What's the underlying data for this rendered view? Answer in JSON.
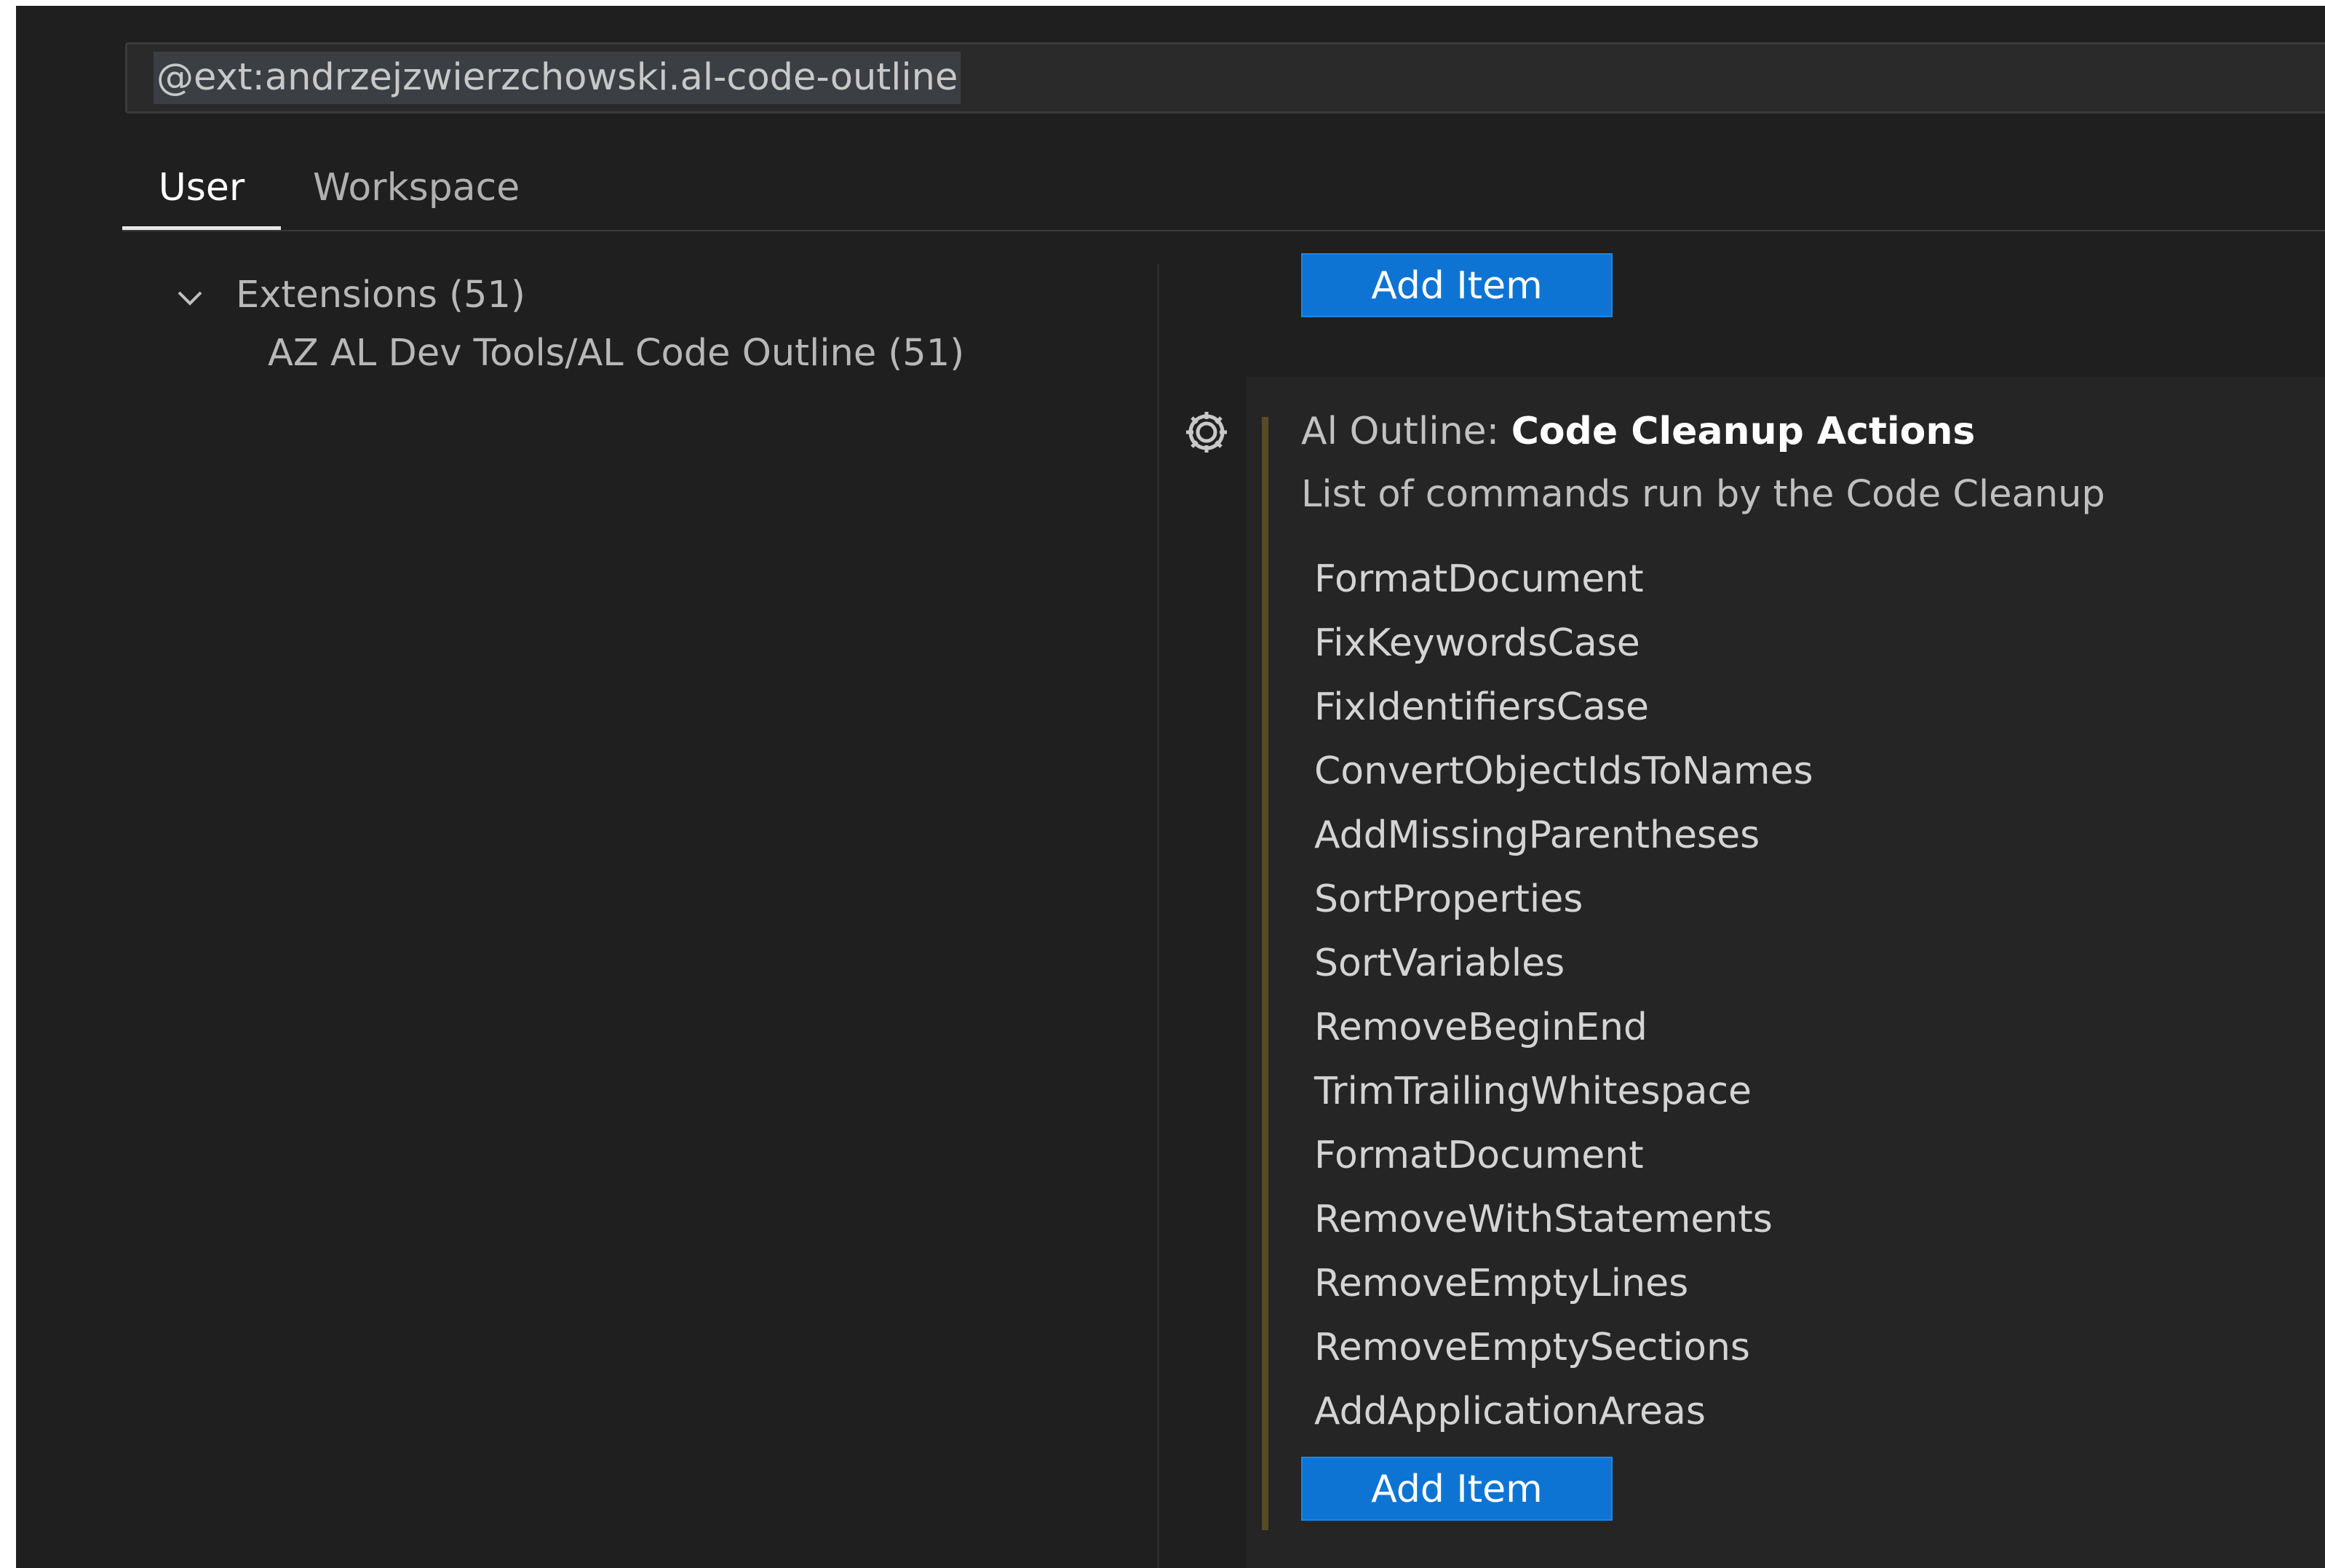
{
  "search": {
    "value": "@ext:andrzejzwierzchowski.al-code-outline"
  },
  "tabs": [
    {
      "label": "User",
      "active": true
    },
    {
      "label": "Workspace",
      "active": false
    }
  ],
  "tree": {
    "group_label": "Extensions (51)",
    "child_label": "AZ AL Dev Tools/AL Code Outline (51)"
  },
  "setting": {
    "category": "Al Outline: ",
    "name": "Code Cleanup Actions",
    "description": "List of commands run by the Code Cleanup",
    "items": [
      "FormatDocument",
      "FixKeywordsCase",
      "FixIdentifiersCase",
      "ConvertObjectIdsToNames",
      "AddMissingParentheses",
      "SortProperties",
      "SortVariables",
      "RemoveBeginEnd",
      "TrimTrailingWhitespace",
      "FormatDocument",
      "RemoveWithStatements",
      "RemoveEmptyLines",
      "RemoveEmptySections",
      "AddApplicationAreas"
    ],
    "add_item_label": "Add Item"
  },
  "previous_setting": {
    "add_item_label": "Add Item"
  },
  "colors": {
    "background": "#1f1f1f",
    "button": "#0e74d4",
    "modified_indicator": "#5a4a24"
  },
  "icons": {
    "tree_toggle": "chevron-down-icon",
    "setting_menu": "gear-icon"
  }
}
